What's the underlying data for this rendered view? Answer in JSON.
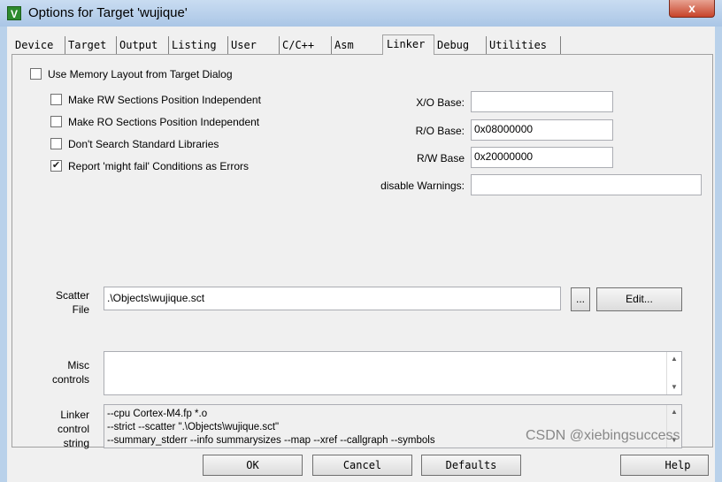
{
  "window": {
    "title": "Options for Target 'wujique'",
    "icon": "keil-uvision-icon",
    "close_label": "x"
  },
  "tabs": [
    {
      "label": "Device"
    },
    {
      "label": "Target"
    },
    {
      "label": "Output"
    },
    {
      "label": "Listing"
    },
    {
      "label": "User"
    },
    {
      "label": "C/C++"
    },
    {
      "label": "Asm"
    },
    {
      "label": "Linker",
      "active": true
    },
    {
      "label": "Debug"
    },
    {
      "label": "Utilities"
    }
  ],
  "linker": {
    "use_memory_layout": {
      "label": "Use Memory Layout from Target Dialog",
      "checked": false
    },
    "options": [
      {
        "label": "Make RW Sections Position Independent",
        "checked": false
      },
      {
        "label": "Make RO Sections Position Independent",
        "checked": false
      },
      {
        "label": "Don't Search Standard Libraries",
        "checked": false
      },
      {
        "label": "Report 'might fail' Conditions as Errors",
        "checked": true
      }
    ],
    "xo_base": {
      "label": "X/O Base:",
      "value": ""
    },
    "ro_base": {
      "label": "R/O Base:",
      "value": "0x08000000"
    },
    "rw_base": {
      "label": "R/W Base",
      "value": "0x20000000"
    },
    "disable_warnings": {
      "label": "disable Warnings:",
      "value": ""
    },
    "scatter_file": {
      "label_line1": "Scatter",
      "label_line2": "File",
      "value": ".\\Objects\\wujique.sct",
      "browse_label": "...",
      "edit_label": "Edit..."
    },
    "misc_controls": {
      "label_line1": "Misc",
      "label_line2": "controls",
      "value": ""
    },
    "linker_control": {
      "label_line1": "Linker",
      "label_line2": "control",
      "label_line3": "string",
      "lines": [
        "--cpu Cortex-M4.fp *.o",
        "--strict --scatter \".\\Objects\\wujique.sct\"",
        "--summary_stderr --info summarysizes --map --xref --callgraph --symbols"
      ]
    }
  },
  "buttons": {
    "ok": "OK",
    "cancel": "Cancel",
    "defaults": "Defaults",
    "help": "Help"
  },
  "watermark": "CSDN @xiebingsuccess"
}
